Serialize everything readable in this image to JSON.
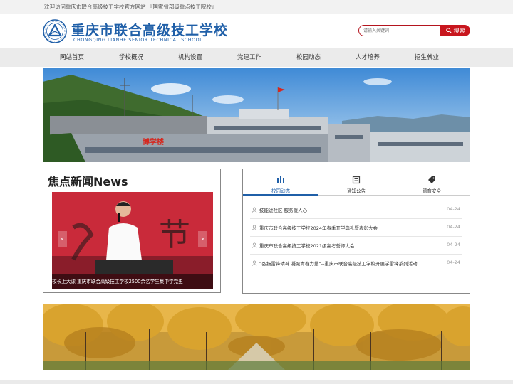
{
  "topbar": {
    "text": "欢迎访问重庆市联合高级技工学校官方网站 『国家省部级重点技工院校』"
  },
  "header": {
    "logo_title": "重庆市联合高级技工学校",
    "logo_subtitle": "CHONGQING LIANHE SENIOR TECHNICAL SCHOOL",
    "search_placeholder": "请输入关键词",
    "search_button": "搜索"
  },
  "nav": {
    "items": [
      "网站首页",
      "学校概况",
      "机构设置",
      "党建工作",
      "校园动态",
      "人才培养",
      "招生就业"
    ]
  },
  "banner": {
    "sign_text": "博学楼"
  },
  "focus_news": {
    "title": "焦点新闻News",
    "slide_text": "节",
    "caption": "校长上大课 重庆市联合高级技工学校2500余名学生集中学党史",
    "prev": "‹",
    "next": "›"
  },
  "news_tabs": {
    "tabs": [
      {
        "label": "校园动态",
        "icon": "graduation-icon"
      },
      {
        "label": "通知公告",
        "icon": "notice-icon"
      },
      {
        "label": "德育安全",
        "icon": "tag-icon"
      }
    ],
    "active_tab": 0,
    "items": [
      {
        "title": "技能进社区 服务暖人心",
        "date": "04-24"
      },
      {
        "title": "重庆市联合高级技工学校2024年春季开学典礼暨表彰大会",
        "date": "04-24"
      },
      {
        "title": "重庆市联合高级技工学校2021级高考誓师大会",
        "date": "04-24"
      },
      {
        "title": "“弘扬雷锋精神 凝聚青春力量”--重庆市联合高级技工学校开展学雷锋系列活动",
        "date": "04-24"
      }
    ]
  },
  "colors": {
    "brand_blue": "#1f5fa8",
    "accent_red": "#c8161e",
    "nav_bg": "#ebebeb"
  }
}
